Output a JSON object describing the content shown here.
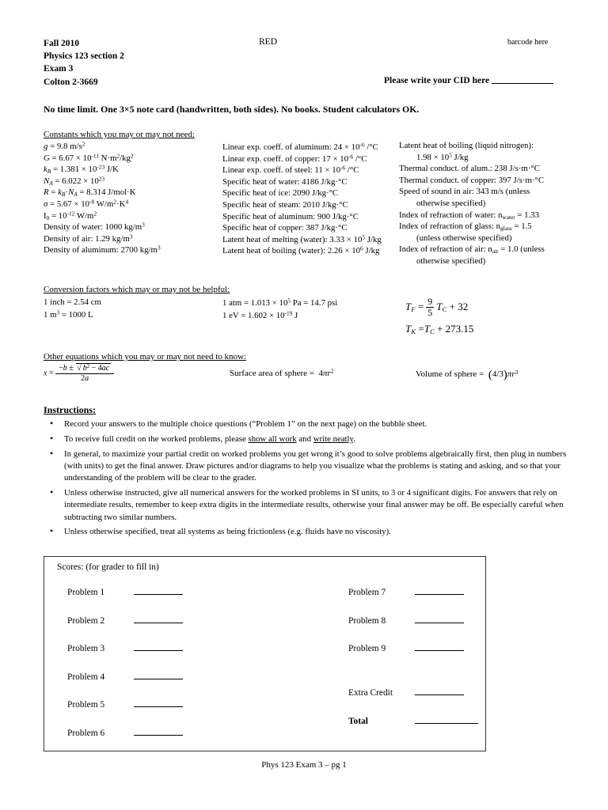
{
  "header": {
    "course_lines": [
      "Fall 2010",
      "Physics 123 section 2",
      "Exam 3",
      "Colton 2-3669"
    ],
    "version": "RED",
    "barcode": "barcode here",
    "cid_label": "Please write your CID here",
    "notice": "No time limit.  One 3×5 note card (handwritten, both sides). No books. Student calculators OK."
  },
  "constants": {
    "heading": "Constants which you may or may not need:",
    "column_a": [
      "g = 9.8 m/s²",
      "G = 6.67 × 10⁻¹¹ N·m²/kg²",
      "k_B = 1.381 × 10⁻²³ J/K",
      "N_A = 6.022 × 10²³",
      "R = k_B N_A = 8.314 J/mol·K",
      "σ = 5.67 × 10⁻⁸ W/m²·K⁴",
      "I₀ = 10⁻¹² W/m²",
      "Density of water: 1000 kg/m³",
      "Density of air: 1.29 kg/m³",
      "Density of aluminum: 2700 kg/m³"
    ],
    "column_b": [
      "Linear exp. coeff. of aluminum: 24 × 10⁻⁶ /°C",
      "Linear exp. coeff. of copper: 17 × 10⁻⁶ /°C",
      "Linear exp. coeff. of steel: 11 × 10⁻⁶ /°C",
      "Specific heat of water: 4186 J/kg·°C",
      "Specific heat of ice: 2090 J/kg·°C",
      "Specific heat of steam: 2010 J/kg·°C",
      "Specific heat of aluminum: 900 J/kg·°C",
      "Specific heat of copper: 387 J/kg·°C",
      "Latent heat of melting (water): 3.33 × 10⁵ J/kg",
      "Latent heat of boiling (water): 2.26 × 10⁶ J/kg"
    ],
    "column_c": [
      "Latent heat of boiling (liquid nitrogen):",
      "1.98 × 10⁵ J/kg",
      "Thermal conduct. of alum.: 238 J/s·m·°C",
      "Thermal conduct. of copper: 397 J/s·m·°C",
      "Speed of sound in air: 343 m/s (unless",
      "otherwise specified)",
      "Index of refraction of water: n_water = 1.33",
      "Index of refraction of glass: n_glass = 1.5",
      "(unless otherwise specified)",
      "Index of refraction of air: n_air = 1.0 (unless",
      "otherwise specified)"
    ]
  },
  "conversions": {
    "heading": "Conversion factors which may or may not be helpful:",
    "column_a": [
      "1 inch = 2.54 cm",
      "1 m³ = 1000 L"
    ],
    "column_b": [
      "1 atm = 1.013 × 10⁵ Pa = 14.7 psi",
      "1 eV = 1.602 × 10⁻¹⁹ J"
    ],
    "temp_formulas": [
      "T_F = (9/5) T_C + 32",
      "T_K = T_C + 273.15"
    ]
  },
  "other_equations": {
    "heading": "Other equations which you may or may not need to know:",
    "quadratic": "x = (−b ± √(b² − 4ac)) / 2a",
    "sphere_area_label": "Surface area of sphere =",
    "sphere_area_value": "4πr²",
    "sphere_volume_label": "Volume of sphere =",
    "sphere_volume_value": "(4/3)πr³"
  },
  "instructions": {
    "title": "Instructions:",
    "items": [
      "Record your answers to the multiple choice questions (“Problem 1” on the next page) on the bubble sheet.",
      "To receive full credit on the worked problems, please show all work and write neatly.",
      "In general, to maximize your partial credit on worked problems you get wrong it’s good to solve problems algebraically first, then plug in numbers (with units) to get the final answer. Draw pictures and/or diagrams to help you visualize what the problems is stating and asking, and so that your understanding of the problem will be clear to the grader.",
      "Unless otherwise instructed, give all numerical answers for the worked problems in SI units, to 3 or 4 significant digits. For answers that rely on intermediate results, remember to keep extra digits in the intermediate results, otherwise your final answer may be off. Be especially careful when subtracting two similar numbers.",
      "Unless otherwise specified, treat all systems as being frictionless (e.g. fluids have no viscosity)."
    ]
  },
  "scores": {
    "title": "Scores: (for grader to fill in)",
    "left_column": [
      "Problem 1",
      "Problem 2",
      "Problem 3",
      "Problem 4",
      "Problem 5",
      "Problem 6"
    ],
    "right_column": [
      "Problem 7",
      "Problem 8",
      "Problem 9"
    ],
    "extra_credit_label": "Extra Credit",
    "total_label": "Total"
  },
  "footer": {
    "text": "Phys 123 Exam 3 – pg 1"
  }
}
